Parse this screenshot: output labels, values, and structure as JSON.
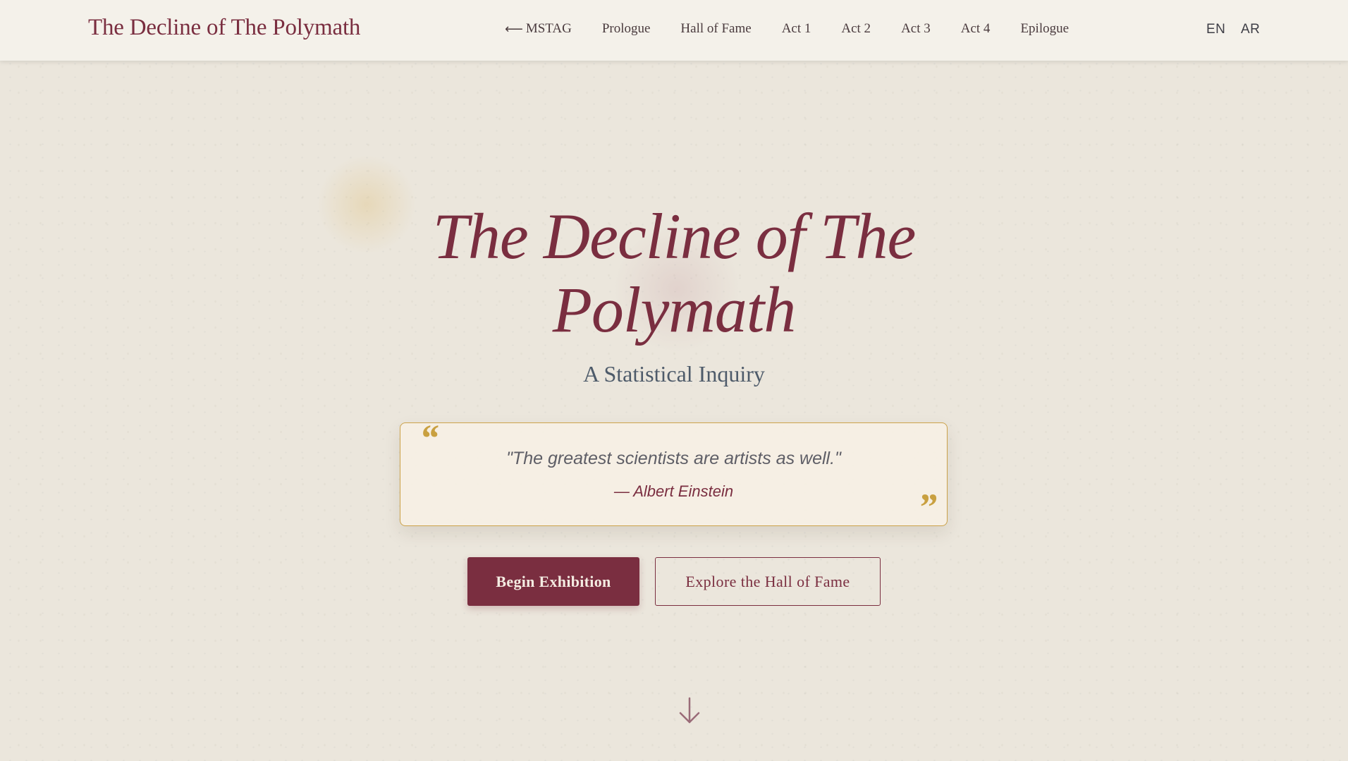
{
  "header": {
    "brand": "The Decline of The Polymath",
    "nav": [
      {
        "label": "MSTAG",
        "icon": "left-arrow-icon"
      },
      {
        "label": "Prologue"
      },
      {
        "label": "Hall of Fame"
      },
      {
        "label": "Act 1"
      },
      {
        "label": "Act 2"
      },
      {
        "label": "Act 3"
      },
      {
        "label": "Act 4"
      },
      {
        "label": "Epilogue"
      }
    ],
    "languages": [
      "EN",
      "AR"
    ]
  },
  "hero": {
    "title_line1": "The Decline of The",
    "title_line2": "Polymath",
    "subtitle": "A Statistical Inquiry",
    "quote": {
      "text": "\"The greatest scientists are artists as well.\"",
      "author": "— Albert Einstein",
      "open_mark": "“",
      "close_mark": "”"
    },
    "primary_button": "Begin Exhibition",
    "secondary_button": "Explore the Hall of Fame",
    "scroll_icon": "down-arrow-icon"
  },
  "colors": {
    "accent": "#7a2e40",
    "gold": "#c9a040",
    "background": "#ebe6dc",
    "header_bg": "#f4f1ea",
    "subtitle": "#4e5b6a"
  }
}
